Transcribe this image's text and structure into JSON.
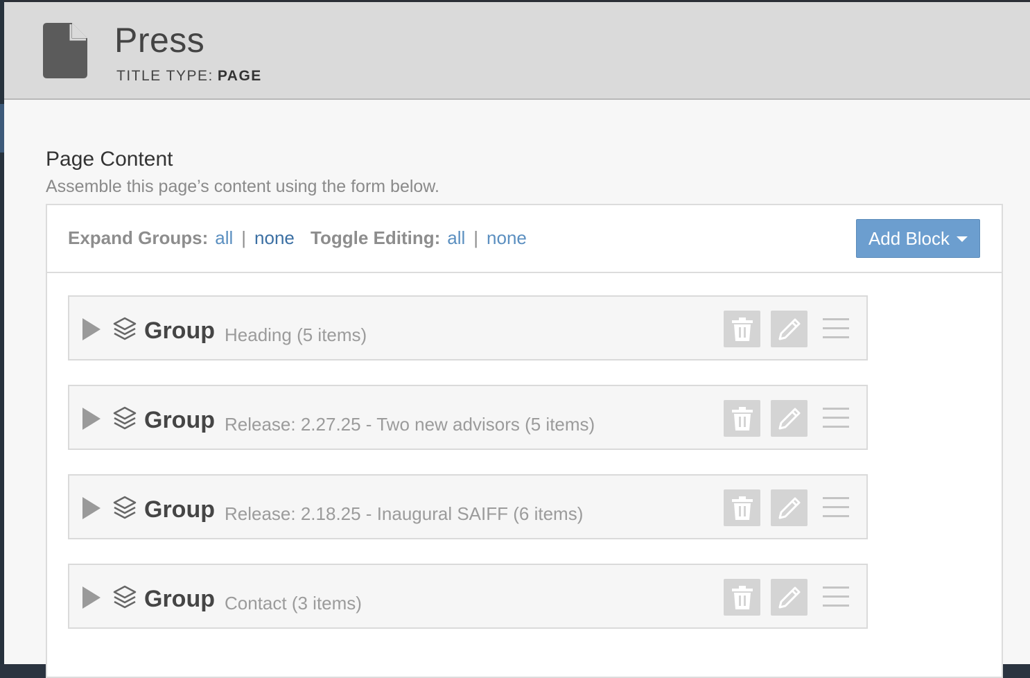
{
  "header": {
    "title": "Press",
    "title_type_label": "TITLE TYPE:",
    "title_type_value": "PAGE",
    "icon": "document-icon"
  },
  "section": {
    "title": "Page Content",
    "subtitle": "Assemble this page’s content using the form below."
  },
  "toolbar": {
    "expand_label": "Expand Groups:",
    "expand_all": "all",
    "expand_none": "none",
    "toggle_label": "Toggle Editing:",
    "toggle_all": "all",
    "toggle_none": "none",
    "separator": "|",
    "add_block": "Add Block"
  },
  "groups": [
    {
      "label": "Group",
      "desc": "Heading (5 items)"
    },
    {
      "label": "Group",
      "desc": "Release: 2.27.25 - Two new advisors (5 items)"
    },
    {
      "label": "Group",
      "desc": "Release: 2.18.25 - Inaugural SAIFF (6 items)"
    },
    {
      "label": "Group",
      "desc": "Contact (3 items)"
    }
  ],
  "icons": {
    "expand": "triangle-right-icon",
    "group": "layers-icon",
    "delete": "trash-icon",
    "edit": "pencil-icon",
    "drag": "drag-handle-icon"
  },
  "colors": {
    "link": "#5b8fc0",
    "button": "#6c9ecf",
    "header_bg": "#dadada"
  }
}
